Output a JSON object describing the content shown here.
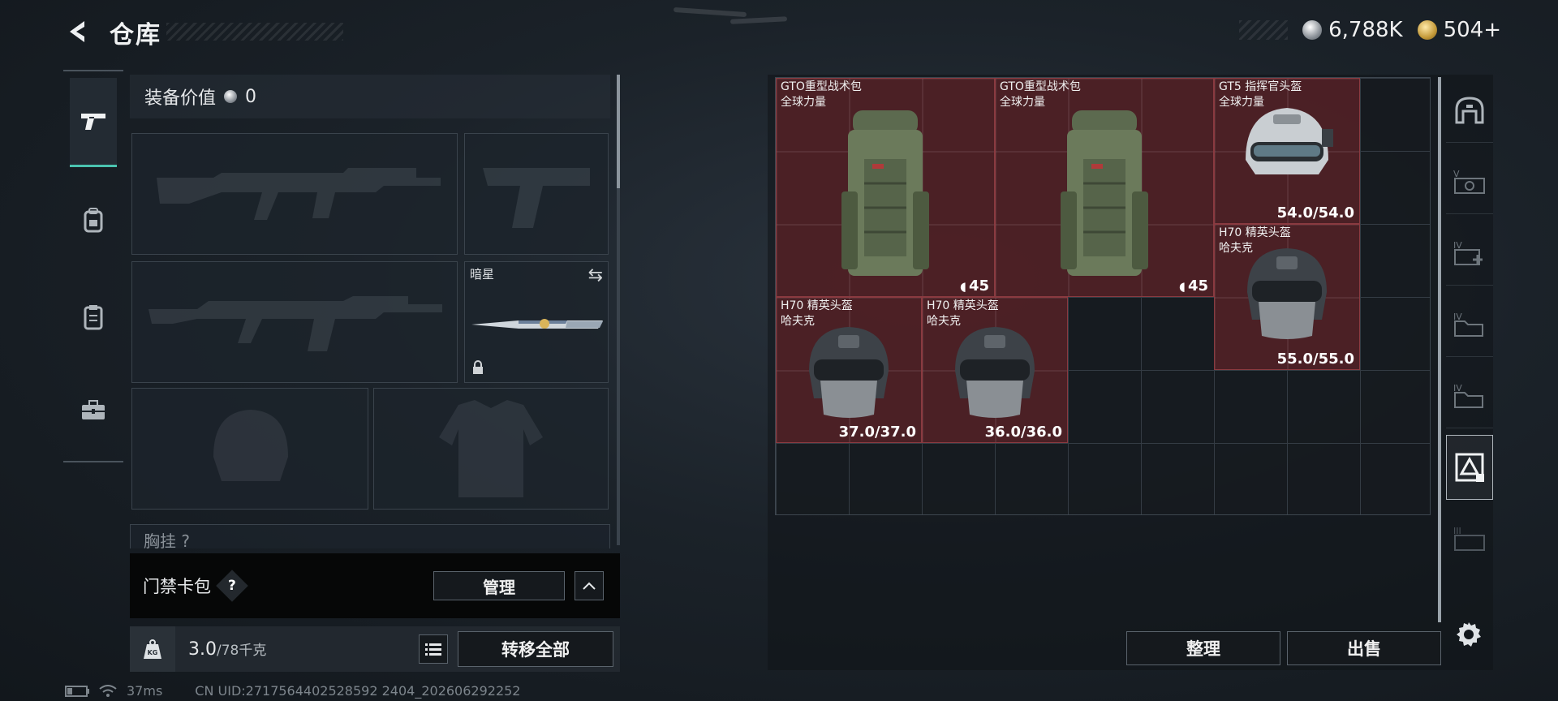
{
  "header": {
    "title": "仓库"
  },
  "currency": [
    {
      "icon": "silver-coin-icon",
      "value": "6,788K"
    },
    {
      "icon": "gold-coin-icon",
      "value": "504+"
    }
  ],
  "nav": [
    {
      "icon": "pistol-icon",
      "active": true
    },
    {
      "icon": "backpack-icon",
      "active": false
    },
    {
      "icon": "vest-icon",
      "active": false
    },
    {
      "icon": "toolbox-icon",
      "active": false
    }
  ],
  "equipment": {
    "value_label": "装备价值",
    "value": "0",
    "knife_label": "暗星",
    "chest_label": "胸挂 ?"
  },
  "keycard": {
    "label": "门禁卡包",
    "help": "?",
    "manage": "管理"
  },
  "weight": {
    "current": "3.0",
    "max": "/78千克",
    "transfer": "转移全部",
    "kg": "KG"
  },
  "status": {
    "latency": "37ms",
    "uid": "CN UID:2717564402528592 2404_202606292252"
  },
  "storage": {
    "items": [
      {
        "name": "GTO重型战术包",
        "sub": "全球力量",
        "value": "45",
        "type": "backpack"
      },
      {
        "name": "GTO重型战术包",
        "sub": "全球力量",
        "value": "45",
        "type": "backpack"
      },
      {
        "name": "GT5 指挥官头盔",
        "sub": "全球力量",
        "value": "54.0/54.0",
        "type": "helmet-light"
      },
      {
        "name": "H70 精英头盔",
        "sub": "哈夫克",
        "value": "55.0/55.0",
        "type": "helmet-dark"
      },
      {
        "name": "H70 精英头盔",
        "sub": "哈夫克",
        "value": "37.0/37.0",
        "type": "helmet-dark"
      },
      {
        "name": "H70 精英头盔",
        "sub": "哈夫克",
        "value": "36.0/36.0",
        "type": "helmet-dark"
      }
    ],
    "sort": "整理",
    "sell": "出售"
  }
}
